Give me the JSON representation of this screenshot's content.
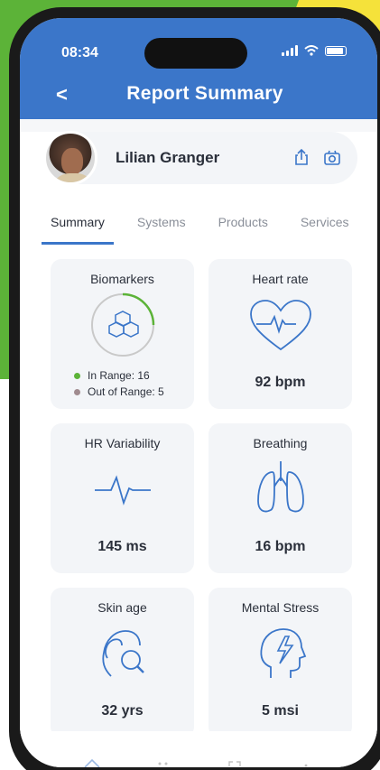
{
  "status_bar": {
    "time": "08:34"
  },
  "header": {
    "back_glyph": "<",
    "title": "Report Summary"
  },
  "profile": {
    "name": "Lilian Granger",
    "icons": [
      "share-icon",
      "camera-icon"
    ]
  },
  "tabs": [
    {
      "label": "Summary",
      "active": true
    },
    {
      "label": "Systems",
      "active": false
    },
    {
      "label": "Products",
      "active": false
    },
    {
      "label": "Services",
      "active": false
    }
  ],
  "cards": {
    "biomarkers": {
      "label": "Biomarkers",
      "in_range": "In Range: 16",
      "out_of_range": "Out of Range: 5",
      "icon": "hexagons-icon"
    },
    "heart_rate": {
      "label": "Heart rate",
      "value": "92 bpm",
      "icon": "heart-pulse-icon"
    },
    "hr_variability": {
      "label": "HR Variability",
      "value": "145 ms",
      "icon": "pulse-line-icon"
    },
    "breathing": {
      "label": "Breathing",
      "value": "16 bpm",
      "icon": "lungs-icon"
    },
    "skin_age": {
      "label": "Skin age",
      "value": "32 yrs",
      "icon": "face-magnifier-icon"
    },
    "mental_stress": {
      "label": "Mental Stress",
      "value": "5 msi",
      "icon": "head-bolt-icon"
    }
  },
  "colors": {
    "accent": "#3b76c9",
    "in_range": "#5cb338",
    "out_of_range": "#a08b8f"
  }
}
